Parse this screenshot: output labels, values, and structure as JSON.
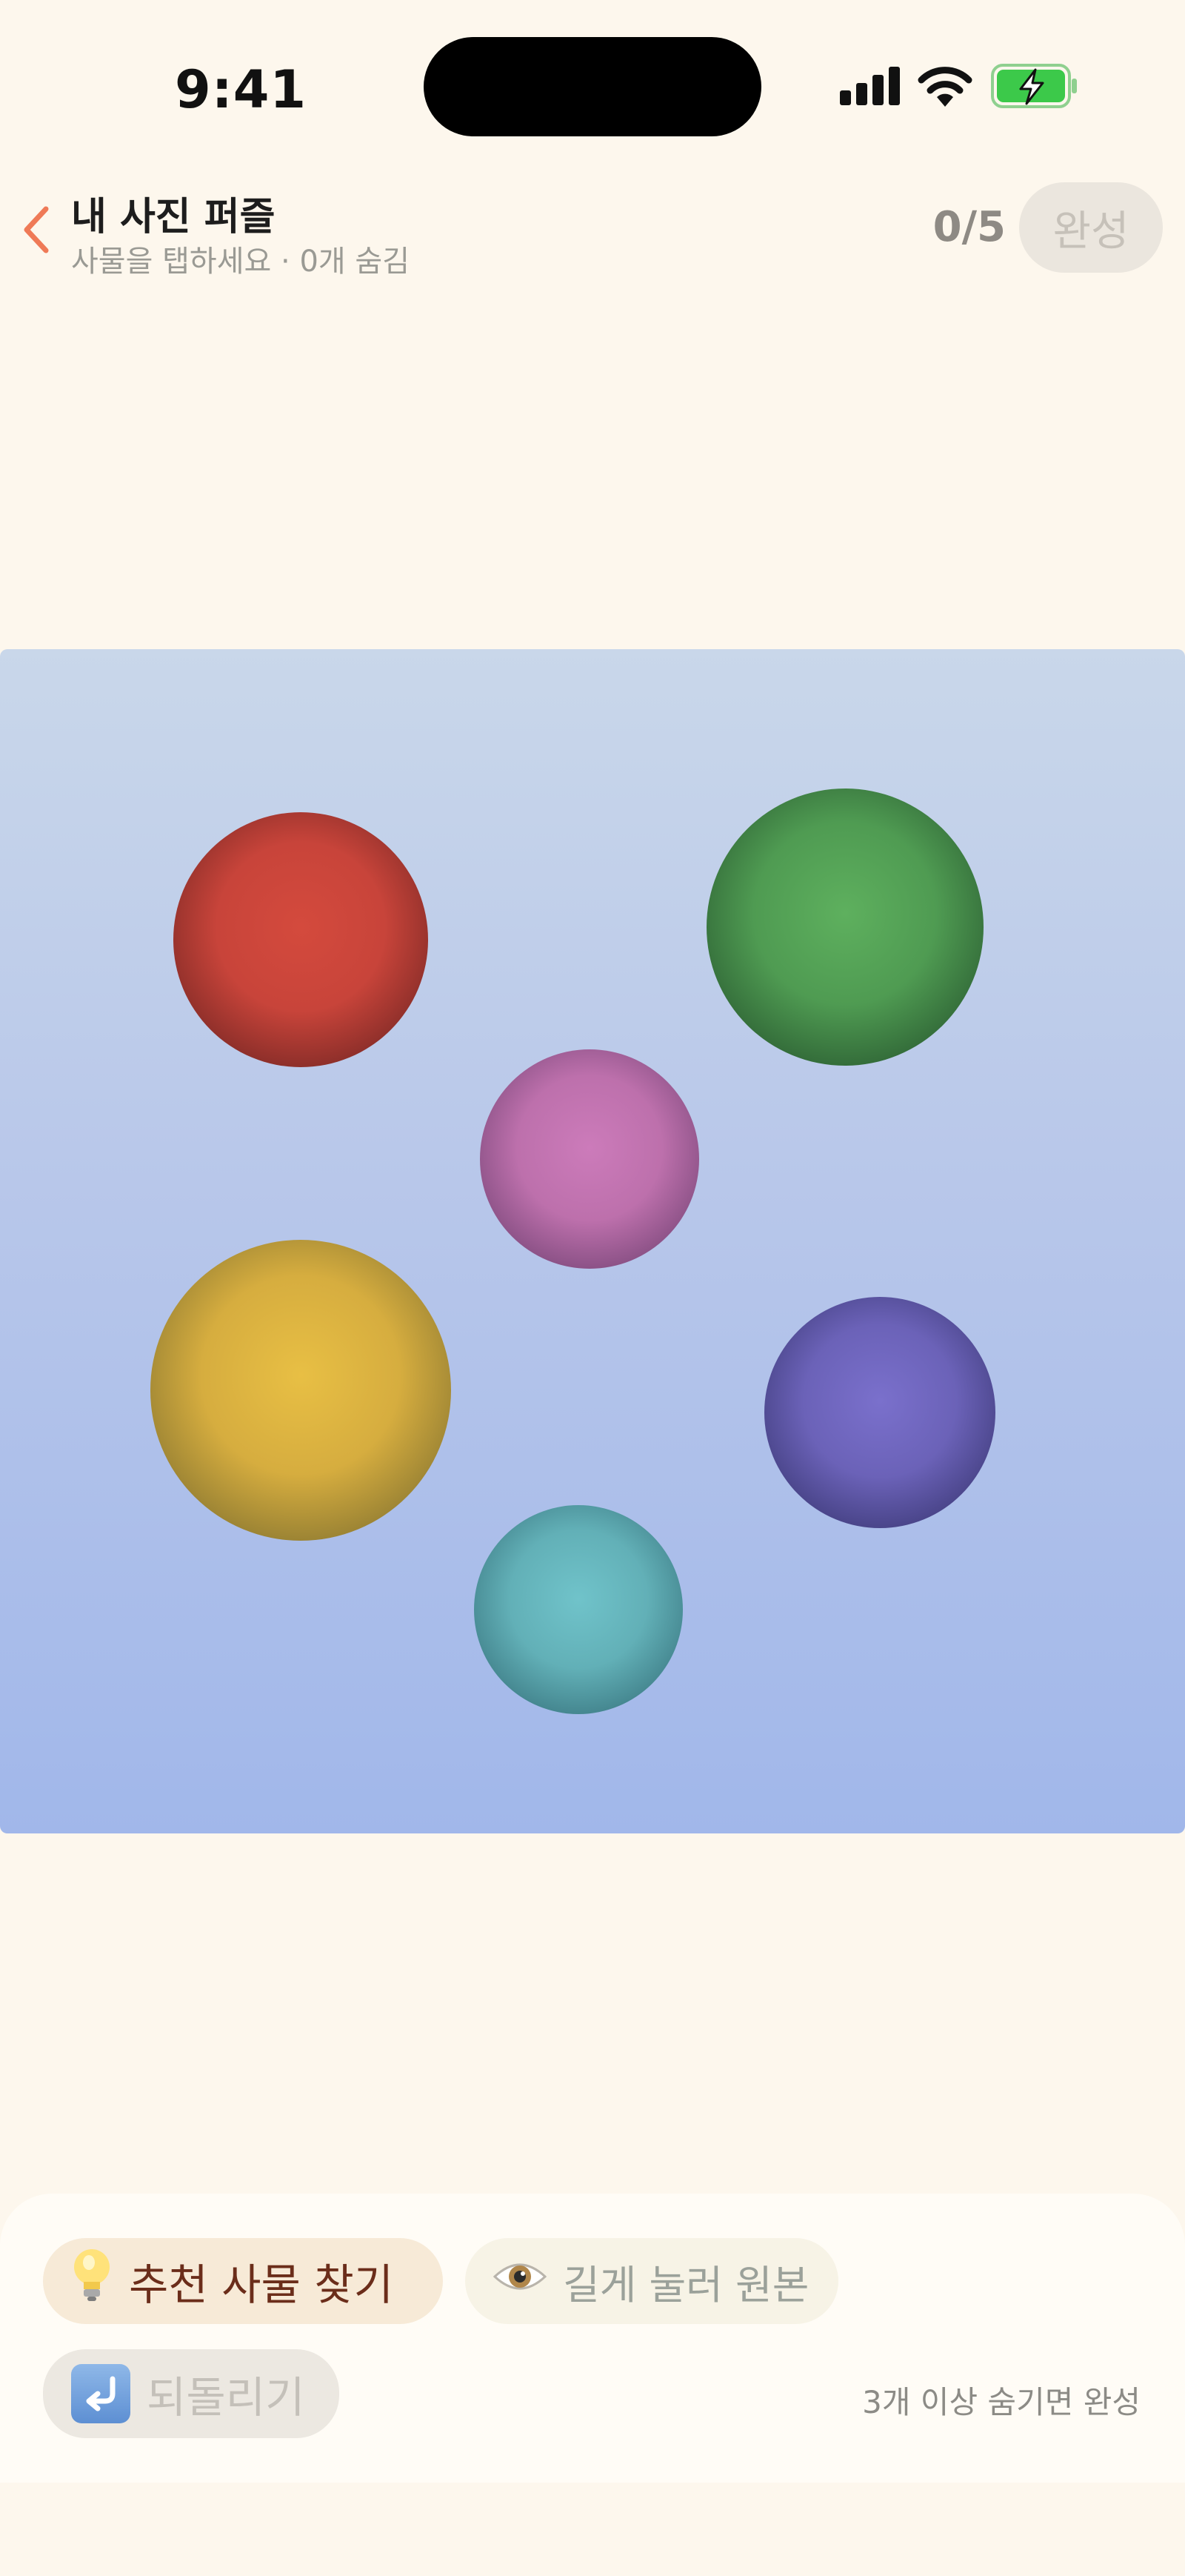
{
  "status_bar": {
    "time": "9:41"
  },
  "header": {
    "back_icon": "chevron-left-icon",
    "title": "내 사진 퍼즐",
    "subtitle": "사물을 탭하세요 · 0개 숨김",
    "counter": "0/5",
    "done_label": "완성"
  },
  "photo": {
    "background_top": "#c9d7ea",
    "background_bottom": "#a1b7ea",
    "objects": [
      {
        "name": "red-ball",
        "color": "#d14a3c"
      },
      {
        "name": "green-ball",
        "color": "#5aaa5c"
      },
      {
        "name": "pink-ball",
        "color": "#c87ab7"
      },
      {
        "name": "yellow-ball",
        "color": "#e5bb45"
      },
      {
        "name": "purple-ball",
        "color": "#7b6fca"
      },
      {
        "name": "teal-ball",
        "color": "#6fc0c8"
      }
    ]
  },
  "toolbar": {
    "suggest_icon": "lightbulb-icon",
    "suggest_label": "추천 사물 찾기",
    "original_icon": "eye-icon",
    "original_label": "길게 눌러 원본",
    "undo_icon": "undo-icon",
    "undo_label": "되돌리기",
    "hint": "3개 이상 숨기면 완성"
  }
}
